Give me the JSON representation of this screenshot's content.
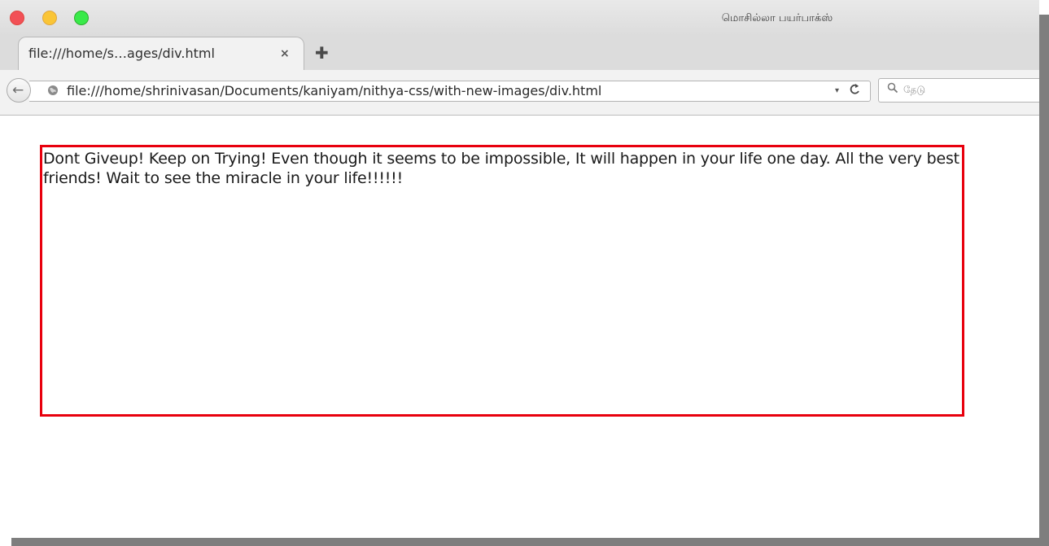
{
  "window": {
    "title": "மொசில்லா பயர்பாக்ஸ்"
  },
  "tab": {
    "title": "file:///home/s…ages/div.html",
    "close_symbol": "×",
    "new_tab_symbol": "✚"
  },
  "navbar": {
    "back_symbol": "←",
    "url": "file:///home/shrinivasan/Documents/kaniyam/nithya-css/with-new-images/div.html",
    "dropdown_symbol": "▾",
    "reload_symbol": "C",
    "search_placeholder": "தேடு"
  },
  "page": {
    "div_text": "Dont Giveup! Keep on Trying! Even though it seems to be impossible, It will happen in your life one day. All the very best friends! Wait to see the miracle in your life!!!!!!",
    "border_color": "#e8000d"
  },
  "icons": {
    "back": "arrow-left-icon",
    "globe": "globe-icon",
    "reload": "reload-icon",
    "search": "search-icon",
    "close": "close-icon",
    "new_tab": "plus-icon"
  }
}
